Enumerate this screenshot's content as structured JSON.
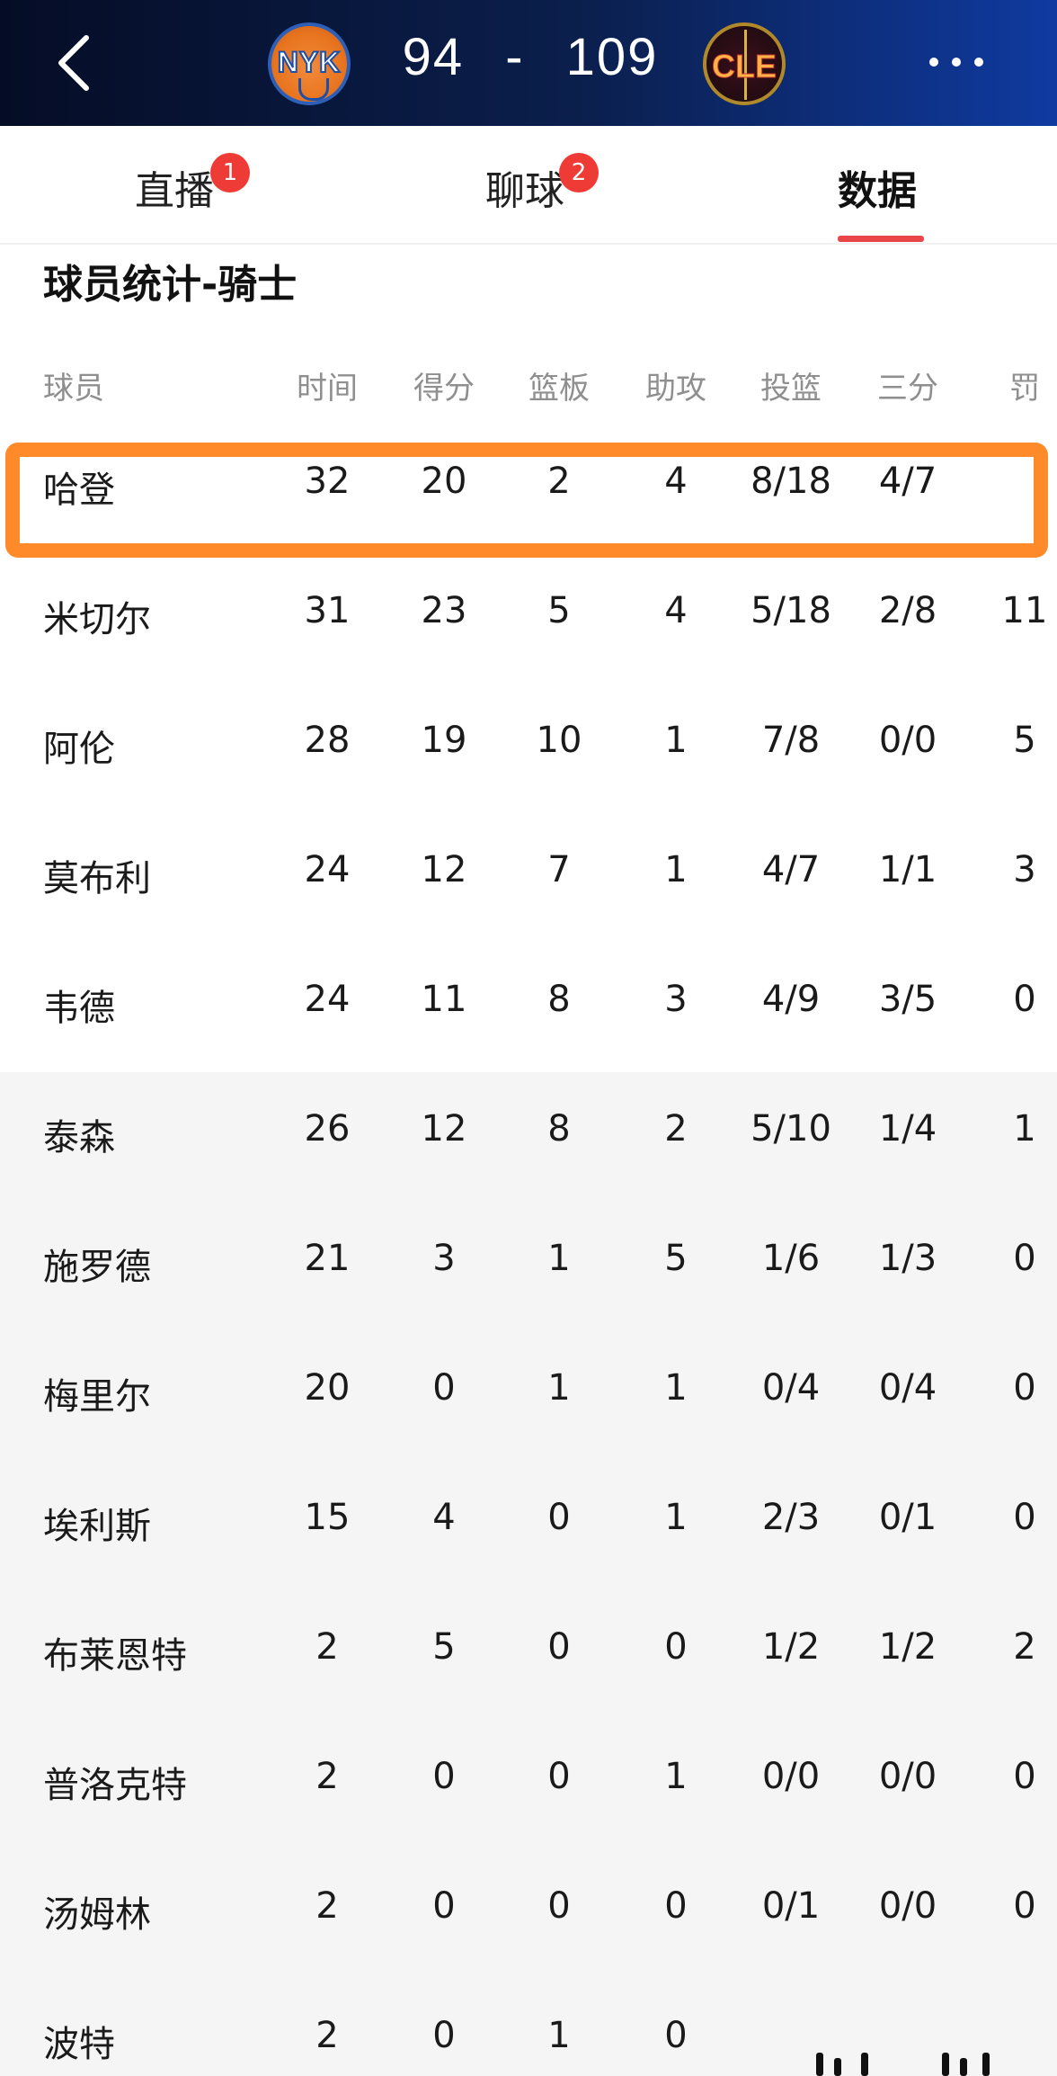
{
  "header": {
    "back_icon": "chevron-left-icon",
    "home_team": "NYK",
    "away_team": "CLE",
    "home_score": "94",
    "separator": "-",
    "away_score": "109",
    "more_icon": "more-horizontal-icon"
  },
  "tabs": [
    {
      "label": "直播",
      "badge": "1"
    },
    {
      "label": "聊球",
      "badge": "2"
    },
    {
      "label": "数据",
      "badge": ""
    }
  ],
  "section_title": "球员统计-骑士",
  "columns": [
    "球员",
    "时间",
    "得分",
    "篮板",
    "助攻",
    "投篮",
    "三分",
    "罚"
  ],
  "rows": [
    {
      "name": "哈登",
      "min": "32",
      "pts": "20",
      "reb": "2",
      "ast": "4",
      "fg": "8/18",
      "tp": "4/7",
      "ft": ""
    },
    {
      "name": "米切尔",
      "min": "31",
      "pts": "23",
      "reb": "5",
      "ast": "4",
      "fg": "5/18",
      "tp": "2/8",
      "ft": "11"
    },
    {
      "name": "阿伦",
      "min": "28",
      "pts": "19",
      "reb": "10",
      "ast": "1",
      "fg": "7/8",
      "tp": "0/0",
      "ft": "5"
    },
    {
      "name": "莫布利",
      "min": "24",
      "pts": "12",
      "reb": "7",
      "ast": "1",
      "fg": "4/7",
      "tp": "1/1",
      "ft": "3"
    },
    {
      "name": "韦德",
      "min": "24",
      "pts": "11",
      "reb": "8",
      "ast": "3",
      "fg": "4/9",
      "tp": "3/5",
      "ft": "0"
    },
    {
      "name": "泰森",
      "min": "26",
      "pts": "12",
      "reb": "8",
      "ast": "2",
      "fg": "5/10",
      "tp": "1/4",
      "ft": "1"
    },
    {
      "name": "施罗德",
      "min": "21",
      "pts": "3",
      "reb": "1",
      "ast": "5",
      "fg": "1/6",
      "tp": "1/3",
      "ft": "0"
    },
    {
      "name": "梅里尔",
      "min": "20",
      "pts": "0",
      "reb": "1",
      "ast": "1",
      "fg": "0/4",
      "tp": "0/4",
      "ft": "0"
    },
    {
      "name": "埃利斯",
      "min": "15",
      "pts": "4",
      "reb": "0",
      "ast": "1",
      "fg": "2/3",
      "tp": "0/1",
      "ft": "0"
    },
    {
      "name": "布莱恩特",
      "min": "2",
      "pts": "5",
      "reb": "0",
      "ast": "0",
      "fg": "1/2",
      "tp": "1/2",
      "ft": "2"
    },
    {
      "name": "普洛克特",
      "min": "2",
      "pts": "0",
      "reb": "0",
      "ast": "1",
      "fg": "0/0",
      "tp": "0/0",
      "ft": "0"
    },
    {
      "name": "汤姆林",
      "min": "2",
      "pts": "0",
      "reb": "0",
      "ast": "0",
      "fg": "0/1",
      "tp": "0/0",
      "ft": "0"
    },
    {
      "name": "波特",
      "min": "2",
      "pts": "0",
      "reb": "1",
      "ast": "0",
      "fg": "",
      "tp": "",
      "ft": ""
    }
  ],
  "highlighted_row": 0,
  "colors": {
    "highlight": "#ff8a2a",
    "tab_underline": "#e9464a",
    "badge": "#ef3b36"
  }
}
